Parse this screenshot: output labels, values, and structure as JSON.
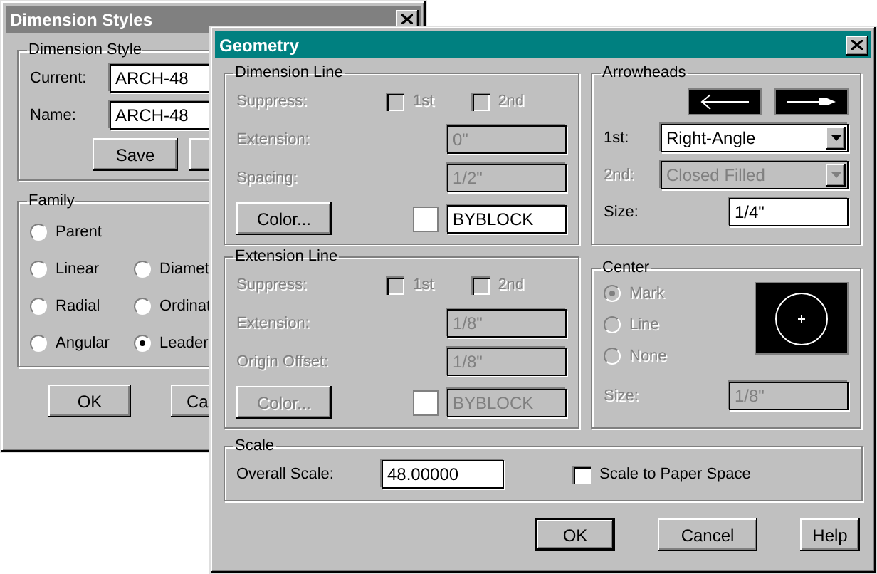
{
  "dimension_styles": {
    "title": "Dimension Styles",
    "active": false,
    "style_group": {
      "title": "Dimension Style",
      "fields": [
        {
          "label": "Current:",
          "value": "ARCH-48"
        },
        {
          "label": "Name:",
          "value": "ARCH-48"
        }
      ],
      "button": "Save"
    },
    "family": {
      "title": "Family",
      "rows": [
        {
          "options": [
            {
              "label": "Parent",
              "selected": false
            }
          ]
        },
        {
          "options": [
            {
              "label": "Linear",
              "selected": false
            },
            {
              "label": "Diamet",
              "selected": false
            }
          ]
        },
        {
          "options": [
            {
              "label": "Radial",
              "selected": false
            },
            {
              "label": "Ordinat",
              "selected": false
            }
          ]
        },
        {
          "options": [
            {
              "label": "Angular",
              "selected": false
            },
            {
              "label": "Leader",
              "selected": true
            }
          ]
        }
      ]
    },
    "buttons": [
      {
        "label": "OK",
        "default": false
      },
      {
        "label": "Ca",
        "default": false
      }
    ]
  },
  "geometry": {
    "title": "Geometry",
    "active": true,
    "dimension_line": {
      "title": "Dimension Line",
      "suppress": {
        "label": "Suppress:",
        "disabled": true,
        "checks": [
          {
            "label": "1st",
            "checked": false,
            "disabled": true
          },
          {
            "label": "2nd",
            "checked": false,
            "disabled": true
          }
        ]
      },
      "fields": [
        {
          "label": "Extension:",
          "value": "0\"",
          "disabled": true
        },
        {
          "label": "Spacing:",
          "value": "1/2\"",
          "disabled": true
        }
      ],
      "color": {
        "button": "Color...",
        "disabled": false,
        "color": "#ffffff",
        "value": "BYBLOCK"
      }
    },
    "extension_line": {
      "title": "Extension Line",
      "suppress": {
        "label": "Suppress:",
        "disabled": true,
        "checks": [
          {
            "label": "1st",
            "checked": false,
            "disabled": true
          },
          {
            "label": "2nd",
            "checked": false,
            "disabled": true
          }
        ]
      },
      "fields": [
        {
          "label": "Extension:",
          "value": "1/8\"",
          "disabled": true
        },
        {
          "label": "Origin Offset:",
          "value": "1/8\"",
          "disabled": true
        }
      ],
      "color": {
        "button": "Color...",
        "disabled": true,
        "color": "#ffffff",
        "value": "BYBLOCK"
      }
    },
    "arrowheads": {
      "title": "Arrowheads",
      "selects": [
        {
          "label": "1st:",
          "value": "Right-Angle",
          "disabled": false
        },
        {
          "label": "2nd:",
          "value": "Closed Filled",
          "disabled": true
        }
      ],
      "size": {
        "label": "Size:",
        "value": "1/4\"",
        "disabled": false
      }
    },
    "center": {
      "title": "Center",
      "options": [
        {
          "label": "Mark",
          "selected": true,
          "disabled": true
        },
        {
          "label": "Line",
          "selected": false,
          "disabled": true
        },
        {
          "label": "None",
          "selected": false,
          "disabled": true
        }
      ],
      "size": {
        "label": "Size:",
        "value": "1/8\"",
        "disabled": true
      }
    },
    "scale": {
      "title": "Scale",
      "overall": {
        "label": "Overall Scale:",
        "value": "48.00000"
      },
      "paper_space": {
        "label": "Scale to Paper Space",
        "checked": false
      }
    },
    "buttons": [
      {
        "label": "OK",
        "default": true
      },
      {
        "label": "Cancel",
        "default": false
      },
      {
        "label": "Help",
        "default": false
      }
    ]
  }
}
